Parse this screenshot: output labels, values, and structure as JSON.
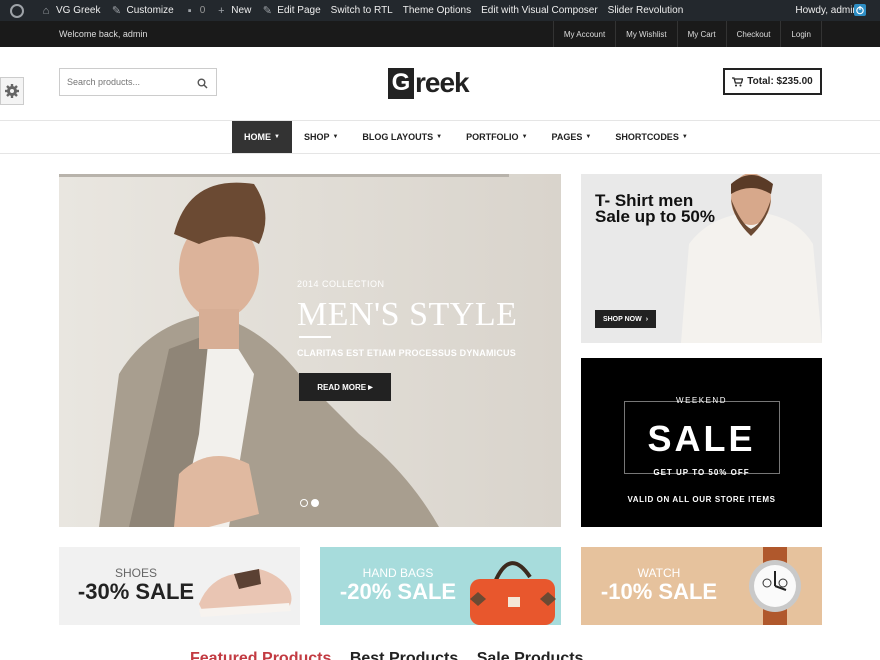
{
  "adminbar": {
    "site_name": "VG Greek",
    "customize": "Customize",
    "comments_count": "0",
    "new": "New",
    "edit_page": "Edit Page",
    "switch_rtl": "Switch to RTL",
    "theme_options": "Theme Options",
    "visual_composer": "Edit with Visual Composer",
    "slider": "Slider Revolution",
    "howdy": "Howdy, admin"
  },
  "topstrip": {
    "welcome": "Welcome back, admin",
    "links": [
      "My Account",
      "My Wishlist",
      "My Cart",
      "Checkout",
      "Login"
    ]
  },
  "header": {
    "search_placeholder": "Search products...",
    "logo_first": "G",
    "logo_rest": "reek",
    "cart_total": "Total: $235.00"
  },
  "nav": {
    "items": [
      {
        "label": "HOME"
      },
      {
        "label": "SHOP"
      },
      {
        "label": "BLOG LAYOUTS"
      },
      {
        "label": "PORTFOLIO"
      },
      {
        "label": "PAGES"
      },
      {
        "label": "SHORTCODES"
      }
    ],
    "active_index": 0
  },
  "hero": {
    "collection": "2014 COLLECTION",
    "headline": "MEN'S STYLE",
    "subtitle": "CLARITAS EST ETIAM PROCESSUS DYNAMICUS",
    "button": "READ MORE",
    "active_slide": 2,
    "slide_count": 2
  },
  "banner_tshirt": {
    "title": "T- Shirt men Sale up to 50%",
    "button": "SHOP NOW"
  },
  "banner_sale": {
    "top": "WEEKEND",
    "big": "SALE",
    "upto": "GET UP TO 50% OFF",
    "valid": "VALID ON ALL OUR STORE ITEMS"
  },
  "categories": [
    {
      "name": "SHOES",
      "sale": "-30% SALE"
    },
    {
      "name": "HAND BAGS",
      "sale": "-20% SALE"
    },
    {
      "name": "WATCH",
      "sale": "-10% SALE"
    }
  ],
  "product_tabs": [
    "Featured Products",
    "Best Products",
    "Sale Products"
  ],
  "colors": {
    "admin_bg": "#23282d",
    "accent_red": "#c23b42",
    "bags_bg": "#a7dcdc",
    "watch_bg": "#e6c29d"
  }
}
